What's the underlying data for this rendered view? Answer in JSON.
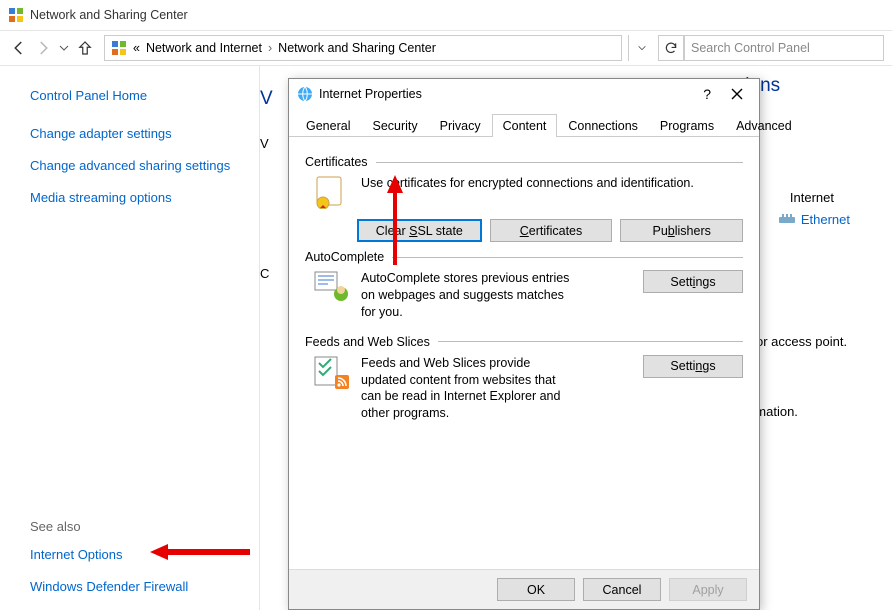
{
  "window_title": "Network and Sharing Center",
  "breadcrumbs": {
    "a": "Network and Internet",
    "b": "Network and Sharing Center"
  },
  "search_placeholder": "Search Control Panel",
  "left": {
    "home": "Control Panel Home",
    "adapter": "Change adapter settings",
    "advanced": "Change advanced sharing settings",
    "media": "Media streaming options",
    "seealso": "See also",
    "iopt": "Internet Options",
    "fw": "Windows Defender Firewall"
  },
  "main": {
    "head_suffix": "tions",
    "peek_V1": "V",
    "peek_V2": "V",
    "peek_C": "C",
    "peek_tail1": "uter or access point.",
    "peek_tail2": "information.",
    "net_label": "Internet",
    "eth": "Ethernet"
  },
  "dlg": {
    "title": "Internet Properties",
    "tabs": {
      "general": "General",
      "security": "Security",
      "privacy": "Privacy",
      "content": "Content",
      "connections": "Connections",
      "programs": "Programs",
      "advanced": "Advanced"
    },
    "certs_label": "Certificates",
    "certs_desc": "Use certificates for encrypted connections and identification.",
    "clear_ssl": "Clear SSL state",
    "certs_btn": "Certificates",
    "pubs_btn": "Publishers",
    "ac_label": "AutoComplete",
    "ac_desc": "AutoComplete stores previous entries on webpages and suggests matches for you.",
    "settings": "Settings",
    "feeds_label": "Feeds and Web Slices",
    "feeds_desc": "Feeds and Web Slices provide updated content from websites that can be read in Internet Explorer and other programs.",
    "ok": "OK",
    "cancel": "Cancel",
    "apply": "Apply"
  }
}
